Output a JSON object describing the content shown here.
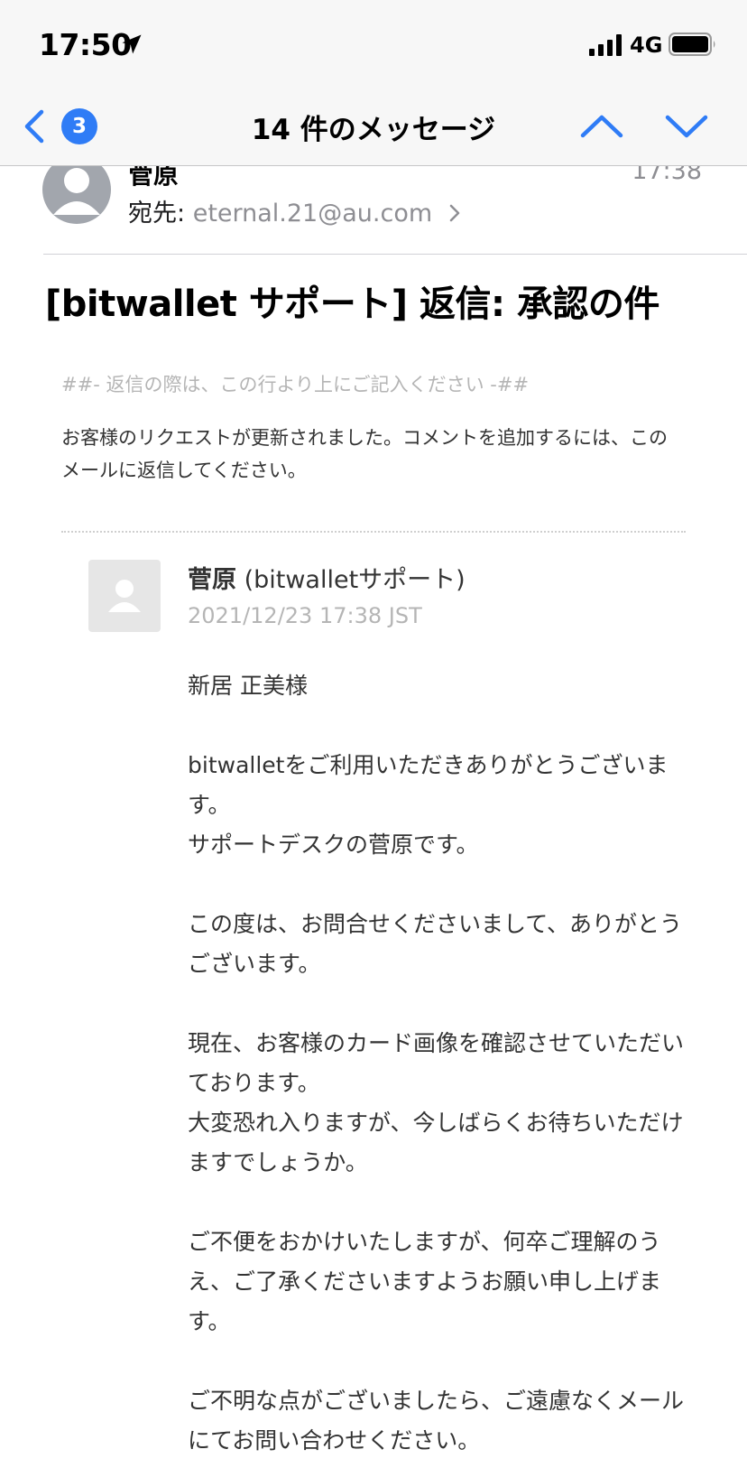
{
  "status_bar": {
    "time": "17:50",
    "network": "4G"
  },
  "nav": {
    "badge_count": "3",
    "title": "14 件のメッセージ"
  },
  "message": {
    "sender": "菅原",
    "time": "17:38",
    "to_label": "宛先:",
    "to_address": "eternal.21@au.com",
    "subject": "[bitwallet サポート] 返信: 承認の件"
  },
  "body": {
    "reply_line": "##- 返信の際は、この行より上にご記入ください -##",
    "notice": "お客様のリクエストが更新されました。コメントを追加するには、このメールに返信してください。",
    "agent_name": "菅原",
    "agent_org": "(bitwalletサポート)",
    "agent_date": "2021/12/23 17:38 JST",
    "paragraphs": [
      "新居 正美様",
      "bitwalletをご利用いただきありがとうございます。\nサポートデスクの菅原です。",
      "この度は、お問合せくださいまして、ありがとうございます。",
      "現在、お客様のカード画像を確認させていただいております。\n大変恐れ入りますが、今しばらくお待ちいただけますでしょうか。",
      "ご不便をおかけいたしますが、何卒ご理解のうえ、ご了承くださいますようお願い申し上げます。",
      "ご不明な点がございましたら、ご遠慮なくメールにてお問い合わせください。"
    ]
  },
  "colors": {
    "accent": "#2f7cf6",
    "secondary_text": "#8e8e93",
    "muted_text": "#b5b5b5"
  }
}
